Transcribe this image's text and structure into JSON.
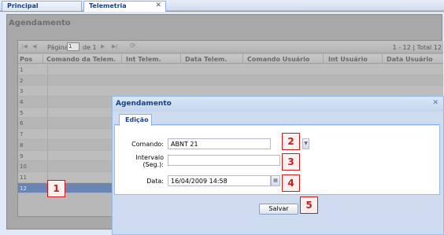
{
  "top_tabs": [
    {
      "label": "Principal",
      "active": false
    },
    {
      "label": "Telemetria",
      "active": true,
      "close_icon": "close-icon"
    }
  ],
  "agendamento": {
    "title": "Agendamento",
    "paging": {
      "page_label": "Página",
      "page_value": "1",
      "of_label": "de 1",
      "info": "1 - 12 | Total 12"
    },
    "columns": [
      "Pos",
      "Comando da Telem.",
      "Int Telem.",
      "Data Telem.",
      "Comando Usuário",
      "Int Usuário",
      "Data Usuário"
    ],
    "rows": [
      "1",
      "2",
      "3",
      "4",
      "5",
      "6",
      "7",
      "8",
      "9",
      "10",
      "11",
      "12"
    ],
    "selected_row": "12"
  },
  "dialog": {
    "title": "Agendamento",
    "tab": "Edição",
    "fields": {
      "comando_label": "Comando:",
      "comando_value": "ABNT 21",
      "intervalo_label_1": "Intervalo",
      "intervalo_label_2": "(Seg.):",
      "intervalo_value": "",
      "data_label": "Data:",
      "data_value": "16/04/2009 14:58"
    },
    "save_label": "Salvar"
  },
  "callouts": [
    "1",
    "2",
    "3",
    "4",
    "5"
  ],
  "colors": {
    "accent": "#15428b",
    "callout": "#c02020",
    "selected_row": "#6a84b4"
  }
}
